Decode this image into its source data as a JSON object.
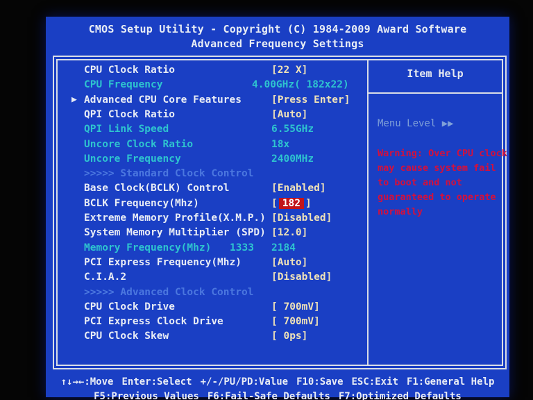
{
  "header": {
    "line1": "CMOS Setup Utility - Copyright (C) 1984-2009 Award Software",
    "line2": "Advanced Frequency Settings"
  },
  "help": {
    "title": "Item Help",
    "menu_level": "Menu Level   ▶▶",
    "warning": "Warning: Over CPU clock may cause system fail to boot and not guaranteed to operate normally"
  },
  "settings": [
    {
      "label": "CPU Clock Ratio",
      "value": "[22 X]",
      "state": "normal"
    },
    {
      "label": "CPU Frequency",
      "value": "4.00GHz( 182x22)",
      "state": "inactive"
    },
    {
      "label": "Advanced CPU Core Features",
      "value": "[Press Enter]",
      "state": "normal",
      "submenu": "▶"
    },
    {
      "label": "QPI Clock Ratio",
      "value": "[Auto]",
      "state": "normal"
    },
    {
      "label": "QPI Link Speed",
      "value": "6.55GHz",
      "state": "inactive"
    },
    {
      "label": "Uncore Clock Ratio",
      "value": "18x",
      "state": "inactive"
    },
    {
      "label": "Uncore Frequency",
      "value": "2400MHz",
      "state": "inactive"
    },
    {
      "label": ">>>>>  Standard Clock Control",
      "value": "",
      "state": "header"
    },
    {
      "label": "Base Clock(BCLK) Control",
      "value": "[Enabled]",
      "state": "normal"
    },
    {
      "label": "BCLK Frequency(Mhz)",
      "value_prefix": "[",
      "value_selected": "182",
      "value_suffix": "]",
      "state": "normal"
    },
    {
      "label": "Extreme Memory Profile(X.M.P.)",
      "value": "[Disabled]",
      "state": "normal"
    },
    {
      "label": "System Memory Multiplier (SPD)",
      "value": "[12.0]",
      "state": "normal"
    },
    {
      "label": "Memory Frequency(Mhz)",
      "extra": "1333",
      "value": "2184",
      "state": "inactive"
    },
    {
      "label": "PCI Express Frequency(Mhz)",
      "value": "[Auto]",
      "state": "normal"
    },
    {
      "label": "C.I.A.2",
      "value": "[Disabled]",
      "state": "normal"
    },
    {
      "label": ">>>>>  Advanced Clock Control",
      "value": "",
      "state": "header"
    },
    {
      "label": "CPU Clock Drive",
      "value": "[ 700mV]",
      "state": "normal"
    },
    {
      "label": "PCI Express Clock Drive",
      "value": "[ 700mV]",
      "state": "normal"
    },
    {
      "label": "CPU Clock Skew",
      "value": "[    0ps]",
      "state": "normal"
    }
  ],
  "footer": {
    "line1": [
      "↑↓→←:Move",
      "Enter:Select",
      "+/-/PU/PD:Value",
      "F10:Save",
      "ESC:Exit",
      "F1:General Help"
    ],
    "line2": [
      "F5:Previous Values",
      "F6:Fail-Safe Defaults",
      "F7:Optimized Defaults"
    ]
  },
  "colors": {
    "background": "#1a3fc4",
    "text": "#e8ecf5",
    "value": "#efe2b8",
    "inactive": "#2ec4cf",
    "section_header": "#4b77df",
    "selection": "#c2141a",
    "warning": "#d4103c"
  }
}
